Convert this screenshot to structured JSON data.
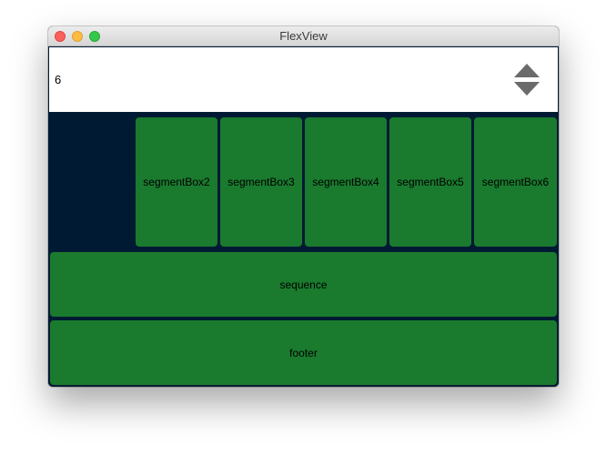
{
  "window": {
    "title": "FlexView"
  },
  "spinbox": {
    "value": "6"
  },
  "segments": [
    {
      "label": "segmentBox2"
    },
    {
      "label": "segmentBox3"
    },
    {
      "label": "segmentBox4"
    },
    {
      "label": "segmentBox5"
    },
    {
      "label": "segmentBox6"
    }
  ],
  "sequence": {
    "label": "sequence"
  },
  "footer": {
    "label": "footer"
  },
  "colors": {
    "background": "#001a33",
    "box": "#1a7a2e",
    "arrow": "#6b6b6b"
  }
}
